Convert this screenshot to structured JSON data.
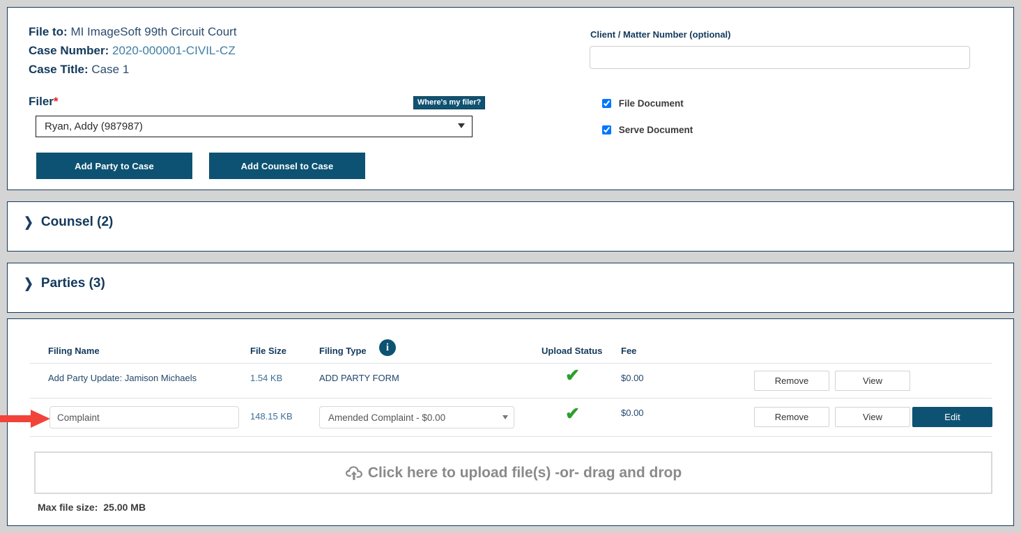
{
  "case": {
    "file_to_label": "File to:",
    "file_to_value": "MI ImageSoft 99th Circuit Court",
    "case_number_label": "Case Number:",
    "case_number_value": "2020-000001-CIVIL-CZ",
    "case_title_label": "Case Title:",
    "case_title_value": "Case 1",
    "filer_label": "Filer",
    "filer_required_mark": "*",
    "filer_tooltip": "Where's my filer?",
    "filer_selected": "Ryan, Addy (987987)",
    "filer_options": [
      "Ryan, Addy (987987)"
    ],
    "add_party_button": "Add Party to Case",
    "add_counsel_button": "Add Counsel to Case"
  },
  "options_panel": {
    "client_matter_label": "Client / Matter Number (optional)",
    "client_matter_value": "",
    "client_matter_placeholder": "",
    "file_document_label": "File Document",
    "file_document_checked": true,
    "serve_document_label": "Serve Document",
    "serve_document_checked": true
  },
  "sections": [
    {
      "title": "Counsel (2)",
      "expanded": false,
      "chevron": "chevron-right-icon"
    },
    {
      "title": "Parties (3)",
      "expanded": false,
      "chevron": "chevron-right-icon"
    }
  ],
  "filings": {
    "columns": {
      "filing_name": "Filing Name",
      "file_size": "File Size",
      "filing_type": "Filing Type",
      "upload_status": "Upload Status",
      "fee": "Fee"
    },
    "info_icon": "info-icon",
    "info_icon_glyph": "i",
    "check_glyph": "✔",
    "rows": [
      {
        "name": "Add Party Update: Jamison Michaels",
        "name_editable": false,
        "size": "1.54 KB",
        "type": "ADD PARTY FORM",
        "type_editable": false,
        "status": "uploaded",
        "fee": "$0.00",
        "remove_label": "Remove",
        "view_label": "View",
        "edit_label": null
      },
      {
        "name": "Complaint",
        "name_editable": true,
        "size": "148.15 KB",
        "type": "Amended Complaint - $0.00",
        "type_editable": true,
        "type_options": [
          "Amended Complaint - $0.00"
        ],
        "status": "uploaded",
        "fee": "$0.00",
        "remove_label": "Remove",
        "view_label": "View",
        "edit_label": "Edit"
      }
    ],
    "dropzone_text": "Click here to upload file(s) -or- drag and drop",
    "dropzone_icon": "cloud-upload-icon",
    "max_file_size_label": "Max file size:",
    "max_file_size_value": "25.00 MB"
  },
  "annotation": {
    "arrow": "red-arrow-pointing-right",
    "color": "#f2433a"
  },
  "colors": {
    "brand_dark": "#0d5272",
    "heading_navy": "#13395c",
    "link_blue": "#3d7fa6",
    "success_green": "#2e9e2e",
    "page_bg": "#d4d4d4",
    "required_red": "#e02020"
  }
}
